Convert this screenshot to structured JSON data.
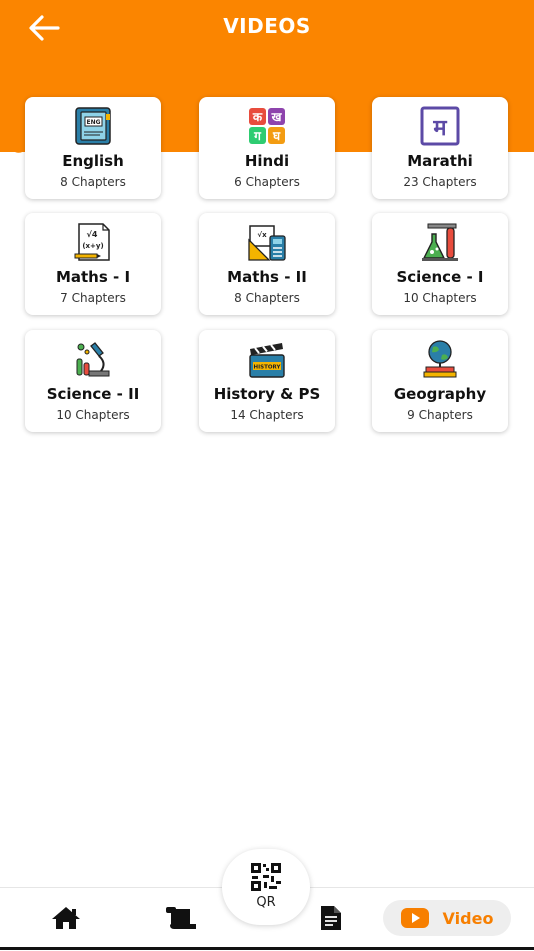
{
  "header": {
    "title": "VIDEOS"
  },
  "subjects": [
    {
      "name": "English",
      "chapters": "8 Chapters",
      "icon": "english-book-icon"
    },
    {
      "name": "Hindi",
      "chapters": "6 Chapters",
      "icon": "hindi-letters-icon"
    },
    {
      "name": "Marathi",
      "chapters": "23 Chapters",
      "icon": "marathi-letter-icon"
    },
    {
      "name": "Maths - I",
      "chapters": "7 Chapters",
      "icon": "math-formula-icon"
    },
    {
      "name": "Maths - II",
      "chapters": "8 Chapters",
      "icon": "geometry-tools-icon"
    },
    {
      "name": "Science - I",
      "chapters": "10 Chapters",
      "icon": "lab-flask-icon"
    },
    {
      "name": "Science - II",
      "chapters": "10 Chapters",
      "icon": "microscope-icon"
    },
    {
      "name": "History & PS",
      "chapters": "14 Chapters",
      "icon": "history-clapboard-icon"
    },
    {
      "name": "Geography",
      "chapters": "9 Chapters",
      "icon": "globe-books-icon"
    }
  ],
  "nav": {
    "qr_label": "QR",
    "video_label": "Video",
    "items": [
      "home-icon",
      "scroll-icon",
      "document-icon",
      "youtube-icon"
    ]
  },
  "colors": {
    "accent": "#fb8500",
    "video_text": "#f77f00"
  }
}
